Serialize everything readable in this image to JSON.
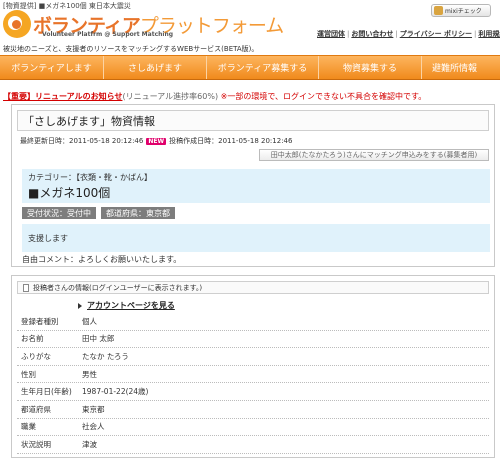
{
  "header": {
    "topline": "[物資提供] ■メガネ100個 東日本大震災",
    "logo_main": "ボランティア",
    "logo_light": "プラットフォーム",
    "logo_sub": "Volunteer Platfrm @ Support Matching",
    "tagline": "被災地のニーズと、支援者のリソースをマッチングするWEBサービス(BETA版)。",
    "mixi_label": "mixiチェック",
    "links": [
      "運営団体",
      "お問い合わせ",
      "プライバシー ポリシー",
      "利用規約"
    ]
  },
  "nav": {
    "items": [
      "ボランティアします",
      "さしあげます",
      "ボランティア募集する",
      "物資募集する",
      "避難所情報"
    ]
  },
  "notice": {
    "link": "【重要】リニューアルのお知らせ",
    "progress": "(リニューアル進捗率60%)",
    "text": "※一部の環境で、ログインできない不具合を確認中です。"
  },
  "post": {
    "title": "「さしあげます」物資情報",
    "updated_label": "最終更新日時：",
    "updated": "2011-05-18 20:12:46",
    "new_badge": "NEW",
    "created_label": "投稿作成日時：",
    "created": "2011-05-18 20:12:46",
    "match_button": "田中太郎(たなかたろう)さんにマッチング申込みをする(募集者用)",
    "category": "カテゴリー：【衣類・靴・かばん】",
    "item": "■メガネ100個",
    "status_tag": "受付状況：受付中",
    "pref_tag": "都道府県：東京都",
    "support": "支援します",
    "comment": "自由コメント：よろしくお願いいたします。"
  },
  "poster": {
    "heading": "投稿者さんの情報(ログインユーザーに表示されます。)",
    "account_link": "アカウントページを見る",
    "rows": [
      {
        "label": "登録者種別",
        "value": "個人"
      },
      {
        "label": "お名前",
        "value": "田中 太郎"
      },
      {
        "label": "ふりがな",
        "value": "たなか たろう"
      },
      {
        "label": "性別",
        "value": "男性"
      },
      {
        "label": "生年月日(年齢)",
        "value": "1987-01-22(24歳)"
      },
      {
        "label": "都道府県",
        "value": "東京都"
      },
      {
        "label": "職業",
        "value": "社会人"
      },
      {
        "label": "状況説明",
        "value": "津波"
      }
    ]
  },
  "colors": {
    "nav_orange": "#f39c2d",
    "notice_red": "#d40000",
    "info_blue": "#e0f2fb",
    "new_badge": "#e0006b"
  }
}
